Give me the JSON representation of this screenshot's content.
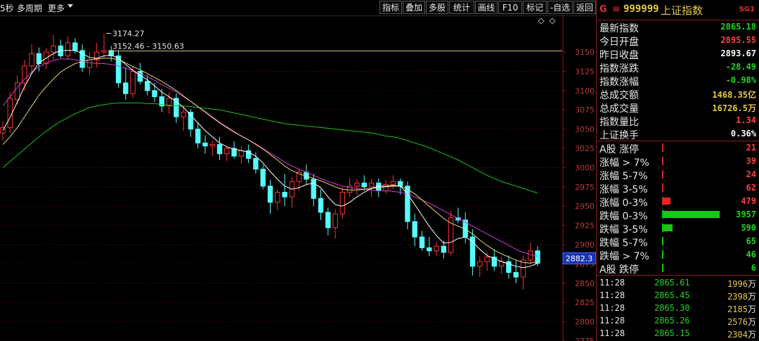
{
  "toolbar": {
    "left_items": [
      "5秒",
      "多周期",
      "更多"
    ],
    "buttons": [
      "指标",
      "叠加",
      "多股",
      "统计",
      "画线",
      "F10",
      "标记",
      "-自选",
      "返回"
    ]
  },
  "chart_data": {
    "type": "candlestick",
    "yticks": [
      3150,
      3125,
      3100,
      3075,
      3050,
      3025,
      3000,
      2975,
      2950,
      2925,
      2900,
      2875,
      2850,
      2825,
      2800,
      2775
    ],
    "ylim": [
      2775,
      3192
    ],
    "annotations": [
      "3174.27",
      "3152.46 - 3150.63"
    ],
    "current_price_label": "2882.3",
    "candles": [
      [
        3045,
        3060,
        3035,
        3052
      ],
      [
        3052,
        3098,
        3045,
        3090
      ],
      [
        3088,
        3120,
        3082,
        3110
      ],
      [
        3110,
        3140,
        3100,
        3132
      ],
      [
        3132,
        3160,
        3122,
        3148
      ],
      [
        3148,
        3156,
        3125,
        3135
      ],
      [
        3135,
        3155,
        3128,
        3150
      ],
      [
        3150,
        3172,
        3140,
        3158
      ],
      [
        3158,
        3166,
        3142,
        3145
      ],
      [
        3145,
        3170,
        3140,
        3162
      ],
      [
        3162,
        3168,
        3148,
        3152
      ],
      [
        3152,
        3160,
        3124,
        3130
      ],
      [
        3130,
        3150,
        3120,
        3140
      ],
      [
        3140,
        3162,
        3130,
        3150
      ],
      [
        3150,
        3174,
        3142,
        3152
      ],
      [
        3152,
        3158,
        3138,
        3145
      ],
      [
        3145,
        3152,
        3104,
        3110
      ],
      [
        3110,
        3130,
        3088,
        3096
      ],
      [
        3096,
        3132,
        3090,
        3125
      ],
      [
        3125,
        3136,
        3108,
        3112
      ],
      [
        3112,
        3120,
        3094,
        3100
      ],
      [
        3100,
        3110,
        3085,
        3092
      ],
      [
        3092,
        3102,
        3072,
        3080
      ],
      [
        3080,
        3098,
        3070,
        3090
      ],
      [
        3090,
        3096,
        3058,
        3066
      ],
      [
        3066,
        3080,
        3048,
        3072
      ],
      [
        3072,
        3076,
        3040,
        3050
      ],
      [
        3050,
        3058,
        3025,
        3032
      ],
      [
        3032,
        3042,
        3018,
        3028
      ],
      [
        3028,
        3035,
        3015,
        3030
      ],
      [
        3030,
        3040,
        3010,
        3018
      ],
      [
        3018,
        3028,
        3008,
        3025
      ],
      [
        3025,
        3034,
        3012,
        3015
      ],
      [
        3015,
        3028,
        3005,
        3022
      ],
      [
        3022,
        3030,
        3006,
        3012
      ],
      [
        3012,
        3020,
        2992,
        2998
      ],
      [
        2998,
        3004,
        2972,
        2976
      ],
      [
        2976,
        2984,
        2940,
        2955
      ],
      [
        2955,
        2972,
        2945,
        2968
      ],
      [
        2968,
        2992,
        2950,
        2962
      ],
      [
        2962,
        2988,
        2948,
        2982
      ],
      [
        2982,
        2998,
        2970,
        2994
      ],
      [
        2994,
        3004,
        2978,
        2985
      ],
      [
        2985,
        2992,
        2950,
        2960
      ],
      [
        2960,
        2972,
        2932,
        2942
      ],
      [
        2942,
        2948,
        2912,
        2922
      ],
      [
        2922,
        2946,
        2908,
        2940
      ],
      [
        2940,
        2975,
        2934,
        2968
      ],
      [
        2968,
        2986,
        2962,
        2976
      ],
      [
        2976,
        2985,
        2964,
        2980
      ],
      [
        2980,
        2990,
        2970,
        2975
      ],
      [
        2975,
        2985,
        2962,
        2980
      ],
      [
        2980,
        2986,
        2962,
        2970
      ],
      [
        2970,
        2984,
        2966,
        2978
      ],
      [
        2978,
        2990,
        2972,
        2982
      ],
      [
        2982,
        2986,
        2965,
        2976
      ],
      [
        2976,
        2982,
        2920,
        2930
      ],
      [
        2930,
        2940,
        2898,
        2910
      ],
      [
        2910,
        2918,
        2892,
        2896
      ],
      [
        2896,
        2910,
        2885,
        2892
      ],
      [
        2892,
        2904,
        2886,
        2898
      ],
      [
        2898,
        2905,
        2882,
        2890
      ],
      [
        2890,
        2944,
        2886,
        2935
      ],
      [
        2935,
        2948,
        2928,
        2932
      ],
      [
        2932,
        2942,
        2902,
        2910
      ],
      [
        2910,
        2920,
        2860,
        2872
      ],
      [
        2872,
        2885,
        2858,
        2878
      ],
      [
        2878,
        2890,
        2866,
        2884
      ],
      [
        2884,
        2894,
        2866,
        2872
      ],
      [
        2872,
        2884,
        2862,
        2878
      ],
      [
        2878,
        2886,
        2856,
        2864
      ],
      [
        2864,
        2880,
        2850,
        2858
      ],
      [
        2858,
        2886,
        2842,
        2880
      ],
      [
        2880,
        2902,
        2874,
        2892
      ],
      [
        2892,
        2898,
        2872,
        2876
      ]
    ],
    "ma_white": [
      3048,
      3065,
      3085,
      3105,
      3122,
      3136,
      3142,
      3148,
      3152,
      3152,
      3152,
      3148,
      3143,
      3142,
      3145,
      3146,
      3142,
      3134,
      3126,
      3120,
      3114,
      3106,
      3098,
      3092,
      3086,
      3078,
      3068,
      3058,
      3048,
      3040,
      3032,
      3027,
      3024,
      3022,
      3020,
      3015,
      3006,
      2995,
      2985,
      2976,
      2972,
      2974,
      2978,
      2980,
      2974,
      2962,
      2952,
      2950,
      2955,
      2962,
      2968,
      2973,
      2976,
      2976,
      2977,
      2976,
      2966,
      2952,
      2938,
      2924,
      2912,
      2902,
      2903,
      2908,
      2910,
      2904,
      2894,
      2886,
      2882,
      2878,
      2875,
      2872,
      2870,
      2872,
      2876
    ],
    "ma_yellow": [
      3030,
      3040,
      3052,
      3066,
      3080,
      3094,
      3105,
      3115,
      3124,
      3130,
      3135,
      3138,
      3140,
      3141,
      3142,
      3142,
      3140,
      3136,
      3131,
      3127,
      3122,
      3117,
      3112,
      3106,
      3100,
      3093,
      3086,
      3079,
      3072,
      3065,
      3058,
      3052,
      3046,
      3041,
      3036,
      3030,
      3024,
      3017,
      3010,
      3002,
      2996,
      2992,
      2989,
      2986,
      2983,
      2979,
      2975,
      2972,
      2971,
      2971,
      2972,
      2973,
      2974,
      2975,
      2976,
      2976,
      2972,
      2966,
      2958,
      2950,
      2942,
      2934,
      2928,
      2924,
      2920,
      2914,
      2906,
      2899,
      2893,
      2888,
      2884,
      2880,
      2877,
      2876,
      2878
    ],
    "ma_magenta": [
      3080,
      3092,
      3104,
      3115,
      3124,
      3131,
      3136,
      3139,
      3141,
      3141,
      3140,
      3138,
      3136,
      3135,
      3135,
      3134,
      3132,
      3129,
      3126,
      3122,
      3118,
      3113,
      3108,
      3103,
      3098,
      3092,
      3086,
      3079,
      3073,
      3066,
      3059,
      3053,
      3047,
      3041,
      3036,
      3031,
      3025,
      3019,
      3013,
      3007,
      3002,
      2998,
      2994,
      2990,
      2986,
      2982,
      2979,
      2976,
      2974,
      2973,
      2972,
      2971,
      2970,
      2970,
      2969,
      2968,
      2966,
      2962,
      2958,
      2954,
      2949,
      2944,
      2939,
      2934,
      2929,
      2924,
      2919,
      2914,
      2909,
      2904,
      2899,
      2894,
      2890,
      2887,
      2885
    ],
    "ma_green": [
      3000,
      3008,
      3016,
      3024,
      3032,
      3040,
      3047,
      3054,
      3060,
      3065,
      3070,
      3074,
      3078,
      3080,
      3082,
      3083,
      3084,
      3084,
      3084,
      3084,
      3083,
      3083,
      3082,
      3081,
      3080,
      3080,
      3079,
      3078,
      3077,
      3076,
      3075,
      3073,
      3071,
      3069,
      3067,
      3065,
      3063,
      3061,
      3059,
      3057,
      3056,
      3055,
      3054,
      3053,
      3052,
      3051,
      3050,
      3049,
      3048,
      3047,
      3046,
      3045,
      3043,
      3041,
      3040,
      3038,
      3035,
      3032,
      3029,
      3026,
      3022,
      3018,
      3014,
      3010,
      3005,
      3000,
      2995,
      2990,
      2986,
      2982,
      2979,
      2976,
      2973,
      2970,
      2967
    ]
  },
  "panel": {
    "header": {
      "prefix": "G",
      "menu_icon": "≡",
      "code": "999999",
      "name": "上证指数",
      "tag": "SG1"
    },
    "stats": [
      {
        "label": "最新指数",
        "value": "2865.18",
        "color": "#1fd61f"
      },
      {
        "label": "今日开盘",
        "value": "2895.55",
        "color": "#ff4040"
      },
      {
        "label": "昨日收盘",
        "value": "2893.67",
        "color": "#ffffff"
      },
      {
        "label": "指数涨跌",
        "value": "-28.49",
        "color": "#1fd61f"
      },
      {
        "label": "指数涨幅",
        "value": "-0.98%",
        "color": "#1fd61f"
      },
      {
        "label": "总成交额",
        "value": "1468.35亿",
        "color": "#e8c84a"
      },
      {
        "label": "总成交量",
        "value": "16726.5万",
        "color": "#e8c84a"
      },
      {
        "label": "指数量比",
        "value": "1.34",
        "color": "#ff4040"
      },
      {
        "label": "上证换手",
        "value": "0.36%",
        "color": "#ffffff"
      }
    ],
    "breadth": [
      {
        "label": "A股 涨停",
        "value": "21",
        "color": "#ff4040",
        "bar": 0,
        "bar_color": "#ff2020",
        "tick": "r"
      },
      {
        "label": "涨幅 > 7%",
        "value": "39",
        "color": "#ff4040",
        "bar": 0,
        "bar_color": "#ff2020",
        "tick": "r"
      },
      {
        "label": "涨幅 5-7%",
        "value": "24",
        "color": "#ff4040",
        "bar": 0,
        "bar_color": "#ff2020",
        "tick": "r"
      },
      {
        "label": "涨幅 3-5%",
        "value": "62",
        "color": "#ff4040",
        "bar": 0,
        "bar_color": "#ff2020",
        "tick": "r"
      },
      {
        "label": "涨幅 0-3%",
        "value": "479",
        "color": "#ff4040",
        "bar": 0.12,
        "bar_color": "#ff2020",
        "tick": "r"
      },
      {
        "label": "跌幅 0-3%",
        "value": "3957",
        "color": "#1fd61f",
        "bar": 1.0,
        "bar_color": "#18c818",
        "tick": "g"
      },
      {
        "label": "跌幅 3-5%",
        "value": "590",
        "color": "#1fd61f",
        "bar": 0.16,
        "bar_color": "#18c818",
        "tick": "g"
      },
      {
        "label": "跌幅 5-7%",
        "value": "65",
        "color": "#1fd61f",
        "bar": 0,
        "bar_color": "#18c818",
        "tick": "g"
      },
      {
        "label": "跌幅 > 7%",
        "value": "46",
        "color": "#1fd61f",
        "bar": 0,
        "bar_color": "#18c818",
        "tick": "g"
      },
      {
        "label": "A股 跌停",
        "value": "6",
        "color": "#1fd61f",
        "bar": 0,
        "bar_color": "#18c818",
        "tick": "g"
      }
    ],
    "ticks": [
      {
        "time": "11:28",
        "price": "2865.61",
        "vol": "1996",
        "unit": "万"
      },
      {
        "time": "11:28",
        "price": "2865.45",
        "vol": "2398",
        "unit": "万"
      },
      {
        "time": "11:28",
        "price": "2865.30",
        "vol": "2185",
        "unit": "万"
      },
      {
        "time": "11:28",
        "price": "2865.26",
        "vol": "2576",
        "unit": "万"
      },
      {
        "time": "11:28",
        "price": "2865.15",
        "vol": "2304",
        "unit": "万"
      }
    ]
  }
}
